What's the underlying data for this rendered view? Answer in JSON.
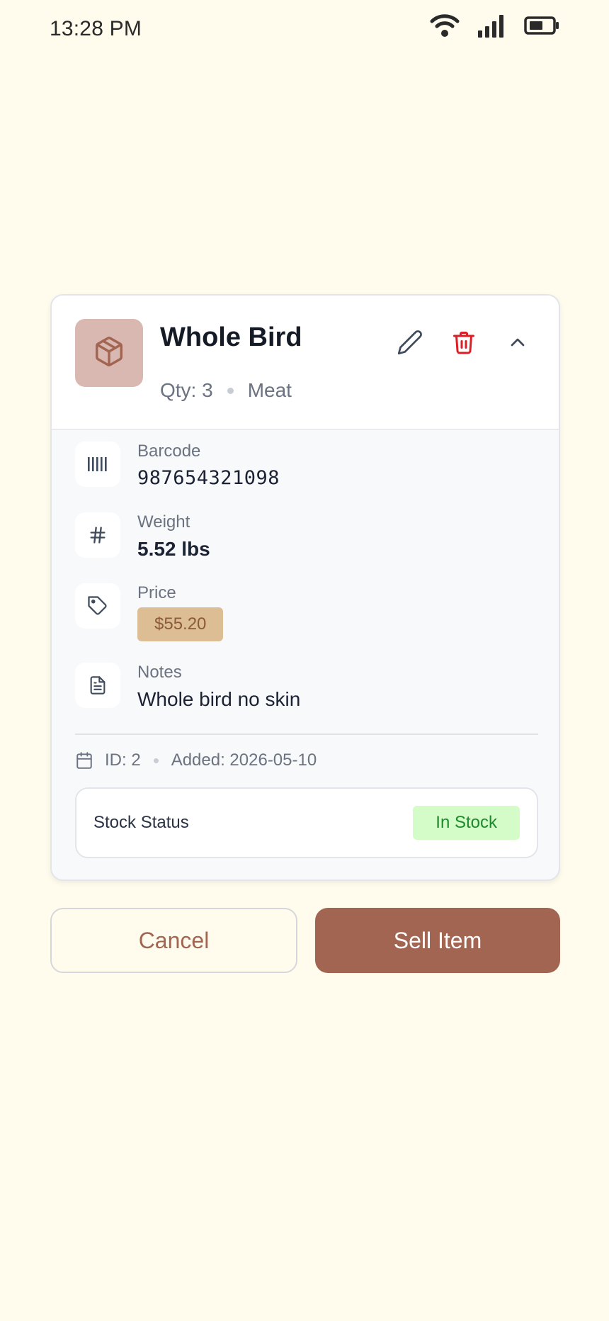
{
  "status_bar": {
    "time": "13:28 PM"
  },
  "item": {
    "title": "Whole Bird",
    "qty_label": "Qty: 3",
    "category": "Meat",
    "barcode_label": "Barcode",
    "barcode_value": "987654321098",
    "weight_label": "Weight",
    "weight_value": "5.52 lbs",
    "price_label": "Price",
    "price_value": "$55.20",
    "notes_label": "Notes",
    "notes_value": "Whole bird no skin",
    "id_label": "ID: 2",
    "added_label": "Added: 2026-05-10",
    "stock_label": "Stock Status",
    "stock_value": "In Stock"
  },
  "actions": {
    "cancel_label": "Cancel",
    "sell_label": "Sell Item"
  },
  "icons": {
    "thumb": "package-icon",
    "edit": "pencil-icon",
    "delete": "trash-icon",
    "collapse": "chevron-up-icon",
    "barcode": "barcode-icon",
    "weight": "hash-icon",
    "price": "tag-icon",
    "notes": "document-icon",
    "date": "calendar-icon"
  },
  "colors": {
    "background": "#fffcee",
    "accent": "#a26551",
    "delete": "#dc1f26",
    "price_pill": "#ddbd94",
    "stock_badge": "#d4fcc9",
    "stock_text": "#1e8a2c"
  }
}
